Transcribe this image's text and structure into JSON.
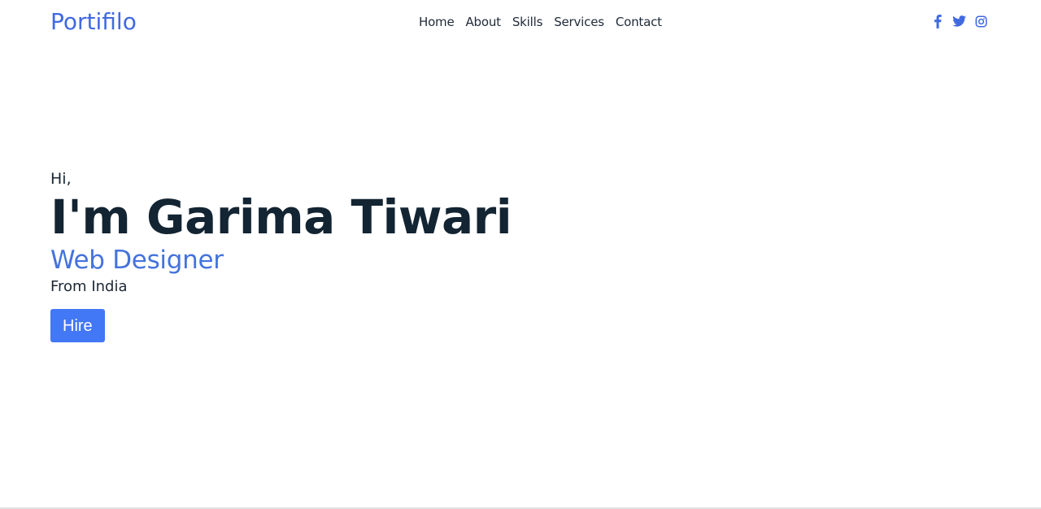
{
  "brand": {
    "name": "Portifilo"
  },
  "nav": {
    "items": [
      {
        "label": "Home"
      },
      {
        "label": "About"
      },
      {
        "label": "Skills"
      },
      {
        "label": "Services"
      },
      {
        "label": "Contact"
      }
    ]
  },
  "social": {
    "icons": [
      "facebook-icon",
      "twitter-icon",
      "instagram-icon"
    ]
  },
  "hero": {
    "greeting": "Hi,",
    "name": "I'm Garima Tiwari",
    "role": "Web Designer",
    "location": "From India",
    "cta_label": "Hire"
  },
  "colors": {
    "accent": "#4169e1",
    "button": "#4277f6",
    "text_dark": "#132432"
  }
}
